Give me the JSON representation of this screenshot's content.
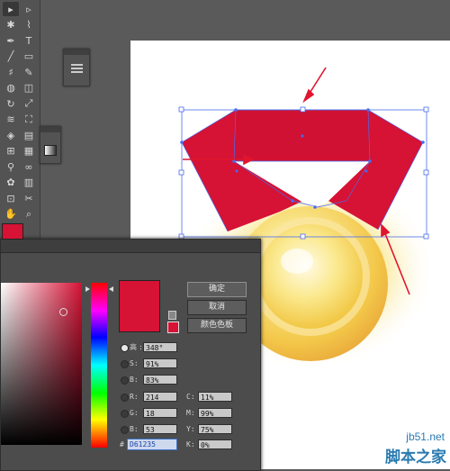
{
  "colors": {
    "accent": "#D61235",
    "canvas_bg": "#5a5a5a",
    "artboard": "#ffffff",
    "selection": "#4a6cf0",
    "arrow": "#e0152f",
    "medal_gold": "#f2c24c"
  },
  "tools": [
    "selection-tool-icon",
    "direct-selection-icon",
    "magic-wand-icon",
    "lasso-icon",
    "pen-icon",
    "type-icon",
    "line-icon",
    "rectangle-icon",
    "paintbrush-icon",
    "pencil-icon",
    "blob-brush-icon",
    "eraser-icon",
    "rotate-icon",
    "scale-icon",
    "warp-icon",
    "free-transform-icon",
    "shape-builder-icon",
    "perspective-icon",
    "mesh-icon",
    "gradient-icon",
    "eyedropper-icon",
    "blend-icon",
    "symbol-sprayer-icon",
    "column-graph-icon",
    "artboard-icon",
    "slice-icon",
    "hand-icon",
    "zoom-icon"
  ],
  "color_picker": {
    "buttons": {
      "ok": "确定",
      "cancel": "取消",
      "swatches": "颜色色板"
    },
    "hsb": [
      {
        "label": "H:",
        "value": "348°",
        "selected": true
      },
      {
        "label": "S:",
        "value": "91%"
      },
      {
        "label": "B:",
        "value": "83%"
      }
    ],
    "rgb": [
      {
        "label": "R:",
        "value": "214"
      },
      {
        "label": "G:",
        "value": "18"
      },
      {
        "label": "B:",
        "value": "53"
      }
    ],
    "cmyk": [
      {
        "label": "C:",
        "value": "11%"
      },
      {
        "label": "M:",
        "value": "99%"
      },
      {
        "label": "Y:",
        "value": "75%"
      },
      {
        "label": "K:",
        "value": "0%"
      }
    ],
    "hex_label": "#",
    "hex_value": "D61235",
    "high_label": "高"
  },
  "watermark": {
    "url": "jb51.net",
    "name": "脚本之家"
  }
}
